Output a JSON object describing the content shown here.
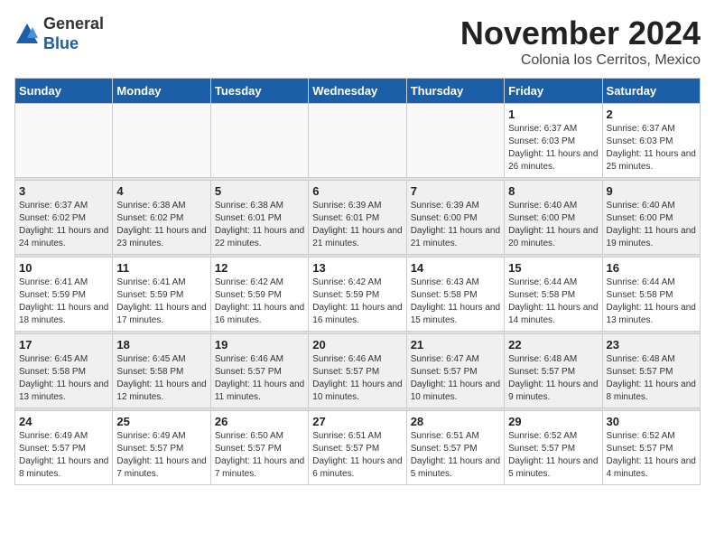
{
  "header": {
    "logo": {
      "general": "General",
      "blue": "Blue"
    },
    "title": "November 2024",
    "location": "Colonia los Cerritos, Mexico"
  },
  "weekdays": [
    "Sunday",
    "Monday",
    "Tuesday",
    "Wednesday",
    "Thursday",
    "Friday",
    "Saturday"
  ],
  "weeks": [
    {
      "alt": false,
      "days": [
        {
          "num": "",
          "empty": true
        },
        {
          "num": "",
          "empty": true
        },
        {
          "num": "",
          "empty": true
        },
        {
          "num": "",
          "empty": true
        },
        {
          "num": "",
          "empty": true
        },
        {
          "num": "1",
          "sunrise": "Sunrise: 6:37 AM",
          "sunset": "Sunset: 6:03 PM",
          "daylight": "Daylight: 11 hours and 26 minutes."
        },
        {
          "num": "2",
          "sunrise": "Sunrise: 6:37 AM",
          "sunset": "Sunset: 6:03 PM",
          "daylight": "Daylight: 11 hours and 25 minutes."
        }
      ]
    },
    {
      "alt": true,
      "days": [
        {
          "num": "3",
          "sunrise": "Sunrise: 6:37 AM",
          "sunset": "Sunset: 6:02 PM",
          "daylight": "Daylight: 11 hours and 24 minutes."
        },
        {
          "num": "4",
          "sunrise": "Sunrise: 6:38 AM",
          "sunset": "Sunset: 6:02 PM",
          "daylight": "Daylight: 11 hours and 23 minutes."
        },
        {
          "num": "5",
          "sunrise": "Sunrise: 6:38 AM",
          "sunset": "Sunset: 6:01 PM",
          "daylight": "Daylight: 11 hours and 22 minutes."
        },
        {
          "num": "6",
          "sunrise": "Sunrise: 6:39 AM",
          "sunset": "Sunset: 6:01 PM",
          "daylight": "Daylight: 11 hours and 21 minutes."
        },
        {
          "num": "7",
          "sunrise": "Sunrise: 6:39 AM",
          "sunset": "Sunset: 6:00 PM",
          "daylight": "Daylight: 11 hours and 21 minutes."
        },
        {
          "num": "8",
          "sunrise": "Sunrise: 6:40 AM",
          "sunset": "Sunset: 6:00 PM",
          "daylight": "Daylight: 11 hours and 20 minutes."
        },
        {
          "num": "9",
          "sunrise": "Sunrise: 6:40 AM",
          "sunset": "Sunset: 6:00 PM",
          "daylight": "Daylight: 11 hours and 19 minutes."
        }
      ]
    },
    {
      "alt": false,
      "days": [
        {
          "num": "10",
          "sunrise": "Sunrise: 6:41 AM",
          "sunset": "Sunset: 5:59 PM",
          "daylight": "Daylight: 11 hours and 18 minutes."
        },
        {
          "num": "11",
          "sunrise": "Sunrise: 6:41 AM",
          "sunset": "Sunset: 5:59 PM",
          "daylight": "Daylight: 11 hours and 17 minutes."
        },
        {
          "num": "12",
          "sunrise": "Sunrise: 6:42 AM",
          "sunset": "Sunset: 5:59 PM",
          "daylight": "Daylight: 11 hours and 16 minutes."
        },
        {
          "num": "13",
          "sunrise": "Sunrise: 6:42 AM",
          "sunset": "Sunset: 5:59 PM",
          "daylight": "Daylight: 11 hours and 16 minutes."
        },
        {
          "num": "14",
          "sunrise": "Sunrise: 6:43 AM",
          "sunset": "Sunset: 5:58 PM",
          "daylight": "Daylight: 11 hours and 15 minutes."
        },
        {
          "num": "15",
          "sunrise": "Sunrise: 6:44 AM",
          "sunset": "Sunset: 5:58 PM",
          "daylight": "Daylight: 11 hours and 14 minutes."
        },
        {
          "num": "16",
          "sunrise": "Sunrise: 6:44 AM",
          "sunset": "Sunset: 5:58 PM",
          "daylight": "Daylight: 11 hours and 13 minutes."
        }
      ]
    },
    {
      "alt": true,
      "days": [
        {
          "num": "17",
          "sunrise": "Sunrise: 6:45 AM",
          "sunset": "Sunset: 5:58 PM",
          "daylight": "Daylight: 11 hours and 13 minutes."
        },
        {
          "num": "18",
          "sunrise": "Sunrise: 6:45 AM",
          "sunset": "Sunset: 5:58 PM",
          "daylight": "Daylight: 11 hours and 12 minutes."
        },
        {
          "num": "19",
          "sunrise": "Sunrise: 6:46 AM",
          "sunset": "Sunset: 5:57 PM",
          "daylight": "Daylight: 11 hours and 11 minutes."
        },
        {
          "num": "20",
          "sunrise": "Sunrise: 6:46 AM",
          "sunset": "Sunset: 5:57 PM",
          "daylight": "Daylight: 11 hours and 10 minutes."
        },
        {
          "num": "21",
          "sunrise": "Sunrise: 6:47 AM",
          "sunset": "Sunset: 5:57 PM",
          "daylight": "Daylight: 11 hours and 10 minutes."
        },
        {
          "num": "22",
          "sunrise": "Sunrise: 6:48 AM",
          "sunset": "Sunset: 5:57 PM",
          "daylight": "Daylight: 11 hours and 9 minutes."
        },
        {
          "num": "23",
          "sunrise": "Sunrise: 6:48 AM",
          "sunset": "Sunset: 5:57 PM",
          "daylight": "Daylight: 11 hours and 8 minutes."
        }
      ]
    },
    {
      "alt": false,
      "days": [
        {
          "num": "24",
          "sunrise": "Sunrise: 6:49 AM",
          "sunset": "Sunset: 5:57 PM",
          "daylight": "Daylight: 11 hours and 8 minutes."
        },
        {
          "num": "25",
          "sunrise": "Sunrise: 6:49 AM",
          "sunset": "Sunset: 5:57 PM",
          "daylight": "Daylight: 11 hours and 7 minutes."
        },
        {
          "num": "26",
          "sunrise": "Sunrise: 6:50 AM",
          "sunset": "Sunset: 5:57 PM",
          "daylight": "Daylight: 11 hours and 7 minutes."
        },
        {
          "num": "27",
          "sunrise": "Sunrise: 6:51 AM",
          "sunset": "Sunset: 5:57 PM",
          "daylight": "Daylight: 11 hours and 6 minutes."
        },
        {
          "num": "28",
          "sunrise": "Sunrise: 6:51 AM",
          "sunset": "Sunset: 5:57 PM",
          "daylight": "Daylight: 11 hours and 5 minutes."
        },
        {
          "num": "29",
          "sunrise": "Sunrise: 6:52 AM",
          "sunset": "Sunset: 5:57 PM",
          "daylight": "Daylight: 11 hours and 5 minutes."
        },
        {
          "num": "30",
          "sunrise": "Sunrise: 6:52 AM",
          "sunset": "Sunset: 5:57 PM",
          "daylight": "Daylight: 11 hours and 4 minutes."
        }
      ]
    }
  ]
}
